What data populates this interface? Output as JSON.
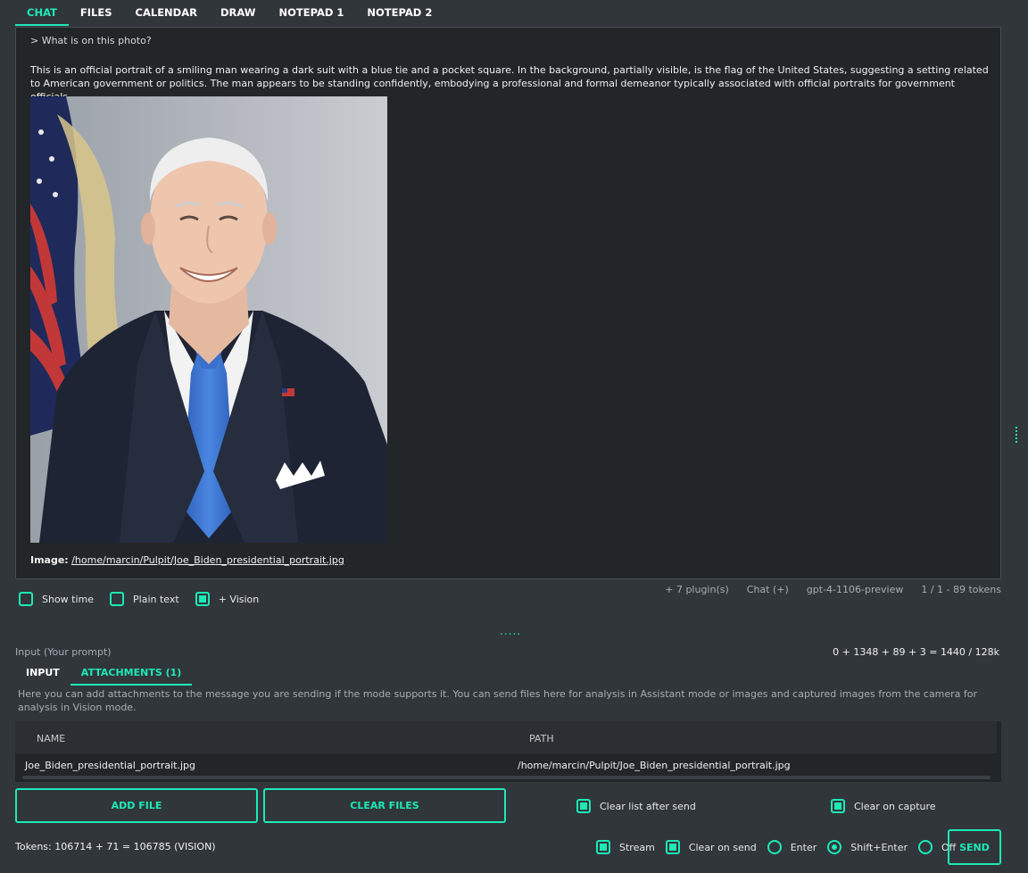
{
  "tabs": [
    {
      "label": "CHAT",
      "active": true
    },
    {
      "label": "FILES",
      "active": false
    },
    {
      "label": "CALENDAR",
      "active": false
    },
    {
      "label": "DRAW",
      "active": false
    },
    {
      "label": "NOTEPAD 1",
      "active": false
    },
    {
      "label": "NOTEPAD 2",
      "active": false
    }
  ],
  "output": {
    "prompt": "> What is on this photo?",
    "answer": "This is an official portrait of a smiling man wearing a dark suit with a blue tie and a pocket square. In the background, partially visible, is the flag of the United States, suggesting a setting related to American government or politics. The man appears to be standing confidently, embodying a professional and formal demeanor typically associated with official portraits for government officials.",
    "image_label": "Image:",
    "image_path": "/home/marcin/Pulpit/Joe_Biden_presidential_portrait.jpg"
  },
  "options": {
    "show_time": {
      "label": "Show time",
      "checked": false
    },
    "plain_text": {
      "label": "Plain text",
      "checked": false
    },
    "vision": {
      "label": "+ Vision",
      "checked": true
    }
  },
  "status": {
    "plugins": "+ 7 plugin(s)",
    "mode": "Chat (+)",
    "model": "gpt-4-1106-preview",
    "tokens": "1 / 1 - 89 tokens"
  },
  "splitter": ".....",
  "input": {
    "label": "Input (Your prompt)",
    "token_sum": "0 + 1348 + 89 + 3 = 1440 / 128k",
    "tabs": [
      {
        "label": "INPUT",
        "active": false
      },
      {
        "label": "ATTACHMENTS (1)",
        "active": true
      }
    ],
    "help": "Here you can add attachments to the message you are sending if the mode supports it. You can send files here for analysis in Assistant mode or images and captured images from the camera for analysis in Vision mode."
  },
  "attachments": {
    "columns": [
      "NAME",
      "PATH"
    ],
    "rows": [
      {
        "name": "Joe_Biden_presidential_portrait.jpg",
        "path": "/home/marcin/Pulpit/Joe_Biden_presidential_portrait.jpg"
      }
    ]
  },
  "buttons": {
    "add_file": "ADD FILE",
    "clear_files": "CLEAR FILES",
    "send": "SEND"
  },
  "attach_options": {
    "clear_list": {
      "label": "Clear list after send",
      "checked": true
    },
    "clear_capture": {
      "label": "Clear on capture",
      "checked": true
    }
  },
  "footer": {
    "tokens": "Tokens: 106714 + 71 = 106785 (VISION)",
    "stream": {
      "label": "Stream",
      "checked": true
    },
    "clear_on_send": {
      "label": "Clear on send",
      "checked": true
    },
    "send_mode": {
      "options": [
        "Enter",
        "Shift+Enter",
        "Off"
      ],
      "selected": "Shift+Enter"
    }
  },
  "colors": {
    "accent": "#1de9b6",
    "background": "#31363b",
    "panel": "#232629"
  }
}
